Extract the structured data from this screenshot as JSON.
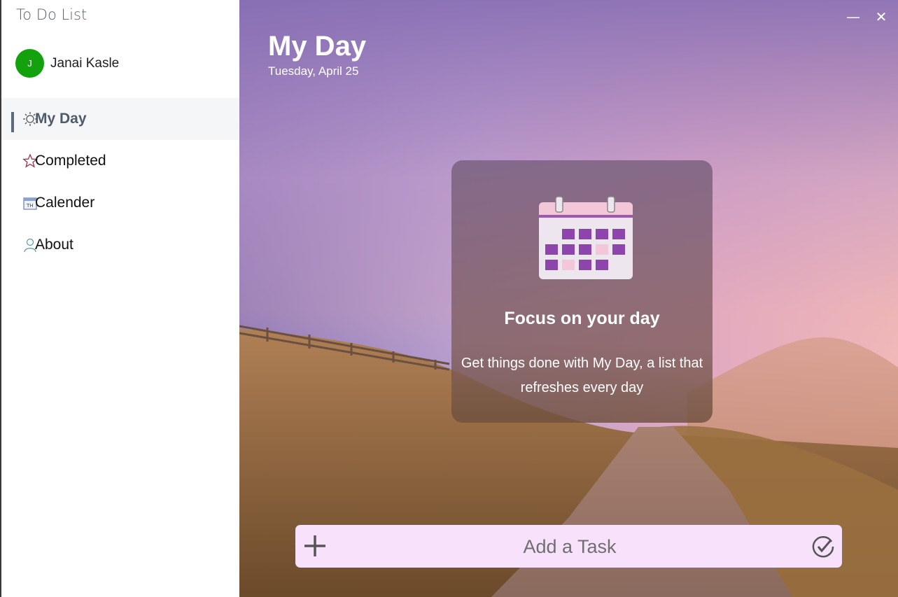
{
  "app": {
    "title": "To Do List"
  },
  "user": {
    "initial": "J",
    "name": "Janai Kasle",
    "avatar_color": "#13a10e"
  },
  "nav": {
    "items": [
      {
        "label": "My Day",
        "icon": "sun-icon",
        "active": true
      },
      {
        "label": "Completed",
        "icon": "star-icon",
        "active": false
      },
      {
        "label": "Calender",
        "icon": "calendar-icon",
        "active": false
      },
      {
        "label": "About",
        "icon": "person-icon",
        "active": false
      }
    ]
  },
  "window_controls": {
    "minimize": "—",
    "close": "✕"
  },
  "main": {
    "title": "My Day",
    "date": "Tuesday, April 25",
    "card": {
      "icon": "calendar-icon",
      "title": "Focus on your day",
      "text": "Get things done with My Day, a list that\nrefreshes every day"
    },
    "add_task": {
      "placeholder": "Add a Task",
      "plus_icon": "plus-icon",
      "check_icon": "check-circle-icon"
    }
  },
  "colors": {
    "accent": "#5d6b79",
    "add_bar": "#f8e2fb",
    "calendar_purple": "#8e44ad",
    "calendar_pink": "#f3c6d8"
  }
}
